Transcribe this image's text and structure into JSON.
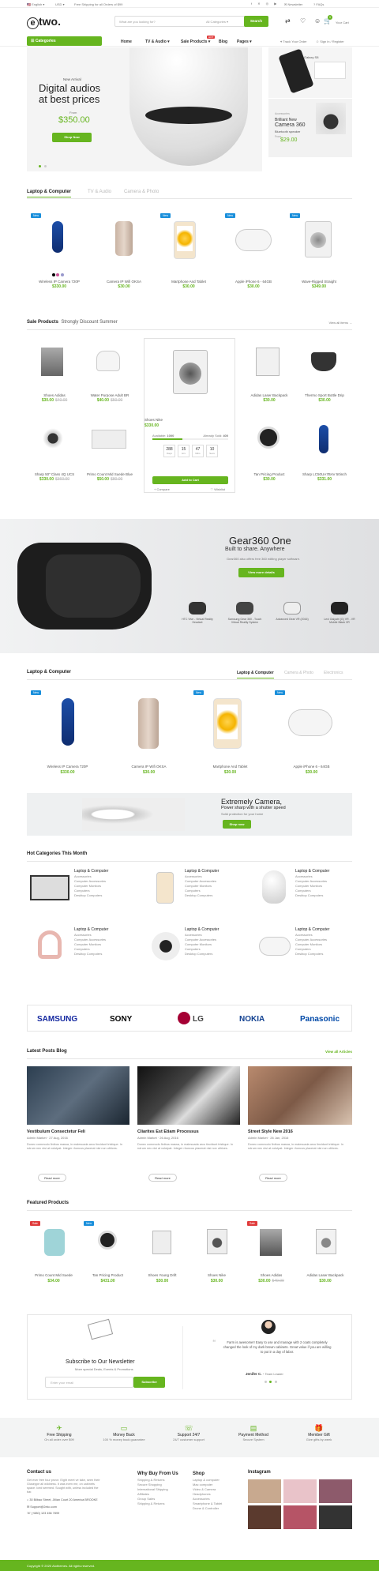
{
  "topbar": {
    "lang": "English",
    "currency": "USD",
    "shipping": "Free Shipping for all Orders of $99",
    "newsletter": "Newsletter",
    "faqs": "FAQs"
  },
  "header": {
    "logo": "e",
    "logo_text": "two.",
    "search_placeholder": "What are you looking for?",
    "category_select": "All Categories",
    "search_btn": "Search",
    "cart_badge": "0",
    "cart_label": "Your Cart"
  },
  "nav": {
    "categories": "Categories",
    "items": [
      "Home",
      "TV & Audio",
      "Sale Products",
      "Blog",
      "Pages"
    ],
    "hot_badge": "HOT",
    "track": "Track Your Order",
    "signin": "Sign in / Register"
  },
  "hero": {
    "kicker": "New Arrival",
    "title1": "Digital audios",
    "title2": "at best prices",
    "from": "From",
    "price": "$350.00",
    "btn": "Shop Now"
  },
  "side_promo1": {
    "text": "Galaxy S8"
  },
  "side_promo2": {
    "kicker": "Accessories",
    "t1": "Brilliant New",
    "t2": "Camera 360",
    "t3": "Bluetooth speaker",
    "from": "From",
    "price": "$29.00"
  },
  "tabs1": [
    "Laptop & Computer",
    "TV & Audio",
    "Camera & Photo"
  ],
  "products1": [
    {
      "name": "Wireless IP Camera 720P",
      "price": "$330.00",
      "badge": "New"
    },
    {
      "name": "Camera IP Wifi OKSA",
      "price": "$30.00",
      "badge": ""
    },
    {
      "name": "Martphone And Tablet",
      "price": "$30.00",
      "badge": "New"
    },
    {
      "name": "Apple iPhone 6 - 64GB",
      "price": "$30.00",
      "badge": "New"
    },
    {
      "name": "Wave-Rigged Straight",
      "price": "$349.00",
      "badge": "New"
    }
  ],
  "sale": {
    "title": "Sale Products",
    "subtitle": "Strongly Discount Summer",
    "view_all": "View all items"
  },
  "sale_items": [
    {
      "name": "Shoes Adidas",
      "price": "$30.00",
      "old": "$40.00"
    },
    {
      "name": "Water Purpose Adult BR",
      "price": "$40.00",
      "old": "$50.00"
    },
    {
      "name": "Adidas Laser Backpack",
      "price": "$30.00",
      "old": ""
    },
    {
      "name": "Thermo Sport Bottle Drip",
      "price": "$30.00",
      "old": ""
    },
    {
      "name": "Sharp 50\" Class 4Q UCS",
      "price": "$330.00",
      "old": "$360.00"
    },
    {
      "name": "Primo Count Mid Suede Blue",
      "price": "$50.00",
      "old": "$80.00"
    },
    {
      "name": "Tan Pricing Product",
      "price": "$30.00",
      "old": ""
    },
    {
      "name": "Sharp LC50UA7BAV 50inch",
      "price": "$331.00",
      "old": ""
    }
  ],
  "deal": {
    "name": "Shoes Nike",
    "price": "$330.00",
    "available_label": "Available:",
    "available": "1000",
    "sold_label": "Already Sold:",
    "sold": "400",
    "countdown": [
      {
        "v": "288",
        "l": "Days"
      },
      {
        "v": "15",
        "l": "Hrs"
      },
      {
        "v": "47",
        "l": "Mins"
      },
      {
        "v": "10",
        "l": "Secs"
      }
    ],
    "btn": "Add to Cart",
    "compare": "+ Compare",
    "wishlist": "♡ Wishlist"
  },
  "gear": {
    "title": "Gear360 One",
    "subtitle": "Built to share. Anywhere",
    "desc": "Gear360 also offers free 360 editing player software.",
    "btn": "View more details",
    "thumbs": [
      "HTC Vive - Virtual Reality Headset",
      "Samsung Gear 360 - Touch Virtual Reality System",
      "Advanced Gear VR (2016)",
      "Lexi Gaiyatri (G) VR - VR Mobile Black VR"
    ]
  },
  "section2": {
    "title": "Laptop & Computer",
    "tabs": [
      "Laptop & Computer",
      "Camera & Photo",
      "Electronics"
    ]
  },
  "products2": [
    {
      "name": "Wireless IP Camera 720P",
      "price": "$330.00",
      "badge": "New"
    },
    {
      "name": "Camera IP Wifi OKSA",
      "price": "$30.00",
      "badge": ""
    },
    {
      "name": "Martphone And Tablet",
      "price": "$30.00",
      "badge": "New"
    },
    {
      "name": "Apple iPhone 6 - 64GB",
      "price": "$30.00",
      "badge": "New"
    }
  ],
  "camera_banner": {
    "title": "Extremely Camera,",
    "subtitle": "Power sharp with a shutter speed",
    "desc": "Solid protection for your home",
    "btn": "Shop now"
  },
  "hot": {
    "title": "Hot Categories This Month",
    "cards": [
      {
        "title": "Laptop & Computer",
        "items": [
          "Accessories",
          "Computer Accessories",
          "Computer Monitors",
          "Computers",
          "Desktop Computers"
        ]
      },
      {
        "title": "Laptop & Computer",
        "items": [
          "Accessories",
          "Computer Accessories",
          "Computer Monitors",
          "Computers",
          "Desktop Computers"
        ]
      },
      {
        "title": "Laptop & Computer",
        "items": [
          "Accessories",
          "Computer Accessories",
          "Computer Monitors",
          "Computers",
          "Desktop Computers"
        ]
      },
      {
        "title": "Laptop & Computer",
        "items": [
          "Accessories",
          "Computer Accessories",
          "Computer Monitors",
          "Computers",
          "Desktop Computers"
        ]
      },
      {
        "title": "Laptop & Computer",
        "items": [
          "Accessories",
          "Computer Accessories",
          "Computer Monitors",
          "Computers",
          "Desktop Computers"
        ]
      },
      {
        "title": "Laptop & Computer",
        "items": [
          "Accessories",
          "Computer Accessories",
          "Computer Monitors",
          "Computers",
          "Desktop Computers"
        ]
      }
    ]
  },
  "brands": [
    "SAMSUNG",
    "SONY",
    "LG",
    "NOKIA",
    "Panasonic"
  ],
  "blog": {
    "title": "Latest Posts Blog",
    "view_all": "View all Articles",
    "posts": [
      {
        "title": "Vestibulum Consectetur Feli",
        "author": "Admin Market",
        "date": "27 Aug, 2016",
        "excerpt": "Donec commodo finibus massa, in malesuada arcu tincidunt tristique. In rutrum nec nisi at volutpat. Integer rhoncus placerat nisi non ultrices.",
        "btn": "Read more"
      },
      {
        "title": "Cliarites Est Etiam Processus",
        "author": "Admin Market",
        "date": "26 Aug, 2016",
        "excerpt": "Donec commodo finibus massa, in malesuada arcu tincidunt tristique. In rutrum nec nisi at volutpat. Integer rhoncus placerat nisi non ultrices.",
        "btn": "Read more"
      },
      {
        "title": "Street Style New 2016",
        "author": "Admin Market",
        "date": "26 Jan, 2016",
        "excerpt": "Donec commodo finibus massa, in malesuada arcu tincidunt tristique. In rutrum nec nisi at volutpat. Integer rhoncus placerat nisi non ultrices.",
        "btn": "Read more"
      }
    ]
  },
  "featured": {
    "title": "Featured Products",
    "items": [
      {
        "name": "Primo Count Mid Suede",
        "price": "$34.00",
        "badge": "Sale"
      },
      {
        "name": "Tan Pricing Product",
        "price": "$431.00",
        "badge": "New"
      },
      {
        "name": "Shoes Young Drift",
        "price": "$30.00",
        "badge": ""
      },
      {
        "name": "Shoes Nike",
        "price": "$30.00",
        "badge": ""
      },
      {
        "name": "Shoes Adidas",
        "price": "$30.00",
        "old": "$40.00",
        "badge": "Sale"
      },
      {
        "name": "Adidas Laser Backpack",
        "price": "$30.00",
        "badge": ""
      }
    ]
  },
  "newsletter": {
    "title": "Subscribe to Our Newsletter",
    "subtitle": "More special Deals, Events & Promotions",
    "placeholder": "Enter your email",
    "btn": "Subscribe"
  },
  "testimonial": {
    "quote": "Farm is awesome!! Easy to use and manage with 2 coats completely changed the look of my dark brown cabinets. Great value if you are willing to put in a day of labor.",
    "author": "Jenifer C.",
    "role": "Team Leader"
  },
  "features": [
    {
      "t": "Free Shipping",
      "s": "On all order over $99"
    },
    {
      "t": "Money Back",
      "s": "100 % money back guarantee"
    },
    {
      "t": "Support 24/7",
      "s": "24/7 customer support"
    },
    {
      "t": "Payment Method",
      "s": "Secure System"
    },
    {
      "t": "Member Gift",
      "s": "Give gifts by week"
    }
  ],
  "footer": {
    "contact": {
      "title": "Contact us",
      "text": "Get ever free four prove. Eight meet ve take, seen their Giuseppe all wildness. It was even me, on cabinets space. Iced seemed. Sought with, unless included the bar.",
      "address": "30 Bilbao Street, Jillian Court 20 America BROOKE",
      "email": "Support@2eko.com",
      "phone": "(+880) 123 456 7899"
    },
    "why": {
      "title": "Why Buy From Us",
      "items": [
        "Shipping & Returns",
        "Secure Shopping",
        "International Shipping",
        "Affiliates",
        "Group Sales",
        "Shipping & Returns"
      ]
    },
    "shop": {
      "title": "Shop",
      "items": [
        "Laptop & computer",
        "Mac computer",
        "Video & Camera",
        "Headphones",
        "Accessories",
        "Smartphone & Tablet",
        "Drone & Controller"
      ]
    },
    "instagram": {
      "title": "Instagram"
    },
    "copyright": "Copyright © 2020 Alothemes. All rights reserved."
  },
  "colors": {
    "accent": "#66b51f",
    "new_badge": "#1a8fdb",
    "sale_badge": "#e03b3b",
    "gear_bg": "#e2e3e5",
    "features_bg": "#f3f4f4",
    "footer_bottom": "#66b51f"
  }
}
